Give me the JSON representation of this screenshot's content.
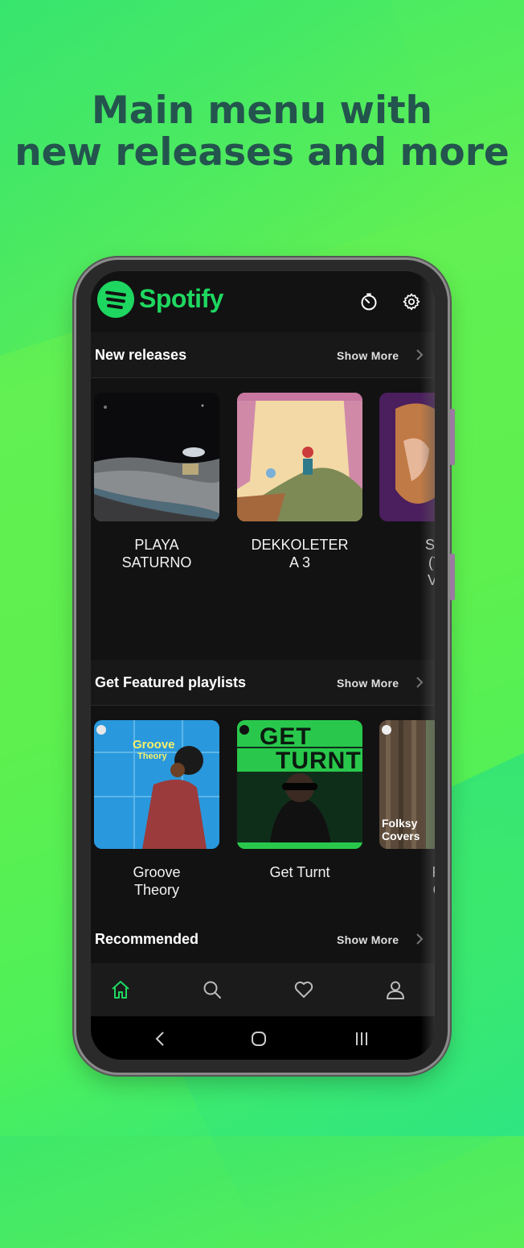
{
  "headline": {
    "line1": "Main menu with",
    "line2": "new releases and more"
  },
  "app": {
    "name": "Spotify",
    "accent": "#1ed760",
    "background": "#121212"
  },
  "appbar": {
    "icons": [
      "timer-icon",
      "settings-gear-icon"
    ]
  },
  "sections": {
    "new_releases": {
      "title": "New releases",
      "show_more": "Show More",
      "items": [
        {
          "line1": "PLAYA",
          "line2": "SATURNO"
        },
        {
          "line1": "DEKKOLETER",
          "line2": "A 3"
        },
        {
          "line1": "Spea",
          "line2": "(Tay",
          "line3": "Vers"
        }
      ]
    },
    "featured": {
      "title": "Get Featured playlists",
      "show_more": "Show More",
      "items": [
        {
          "line1": "Groove",
          "line2": "Theory",
          "cover_text1": "Groove",
          "cover_text2": "Theory"
        },
        {
          "line1": "Get Turnt",
          "cover_text1": "GET",
          "cover_text2": "TURNT"
        },
        {
          "line1": "Fol",
          "line2": "Co",
          "cover_text1": "Folksy",
          "cover_text2": "Covers"
        }
      ]
    },
    "recommended": {
      "title": "Recommended",
      "show_more": "Show More"
    }
  },
  "bottom_nav": [
    "home-icon",
    "search-icon",
    "heart-icon",
    "profile-icon"
  ],
  "system_nav": [
    "back-icon",
    "home-circle-icon",
    "recents-icon"
  ]
}
